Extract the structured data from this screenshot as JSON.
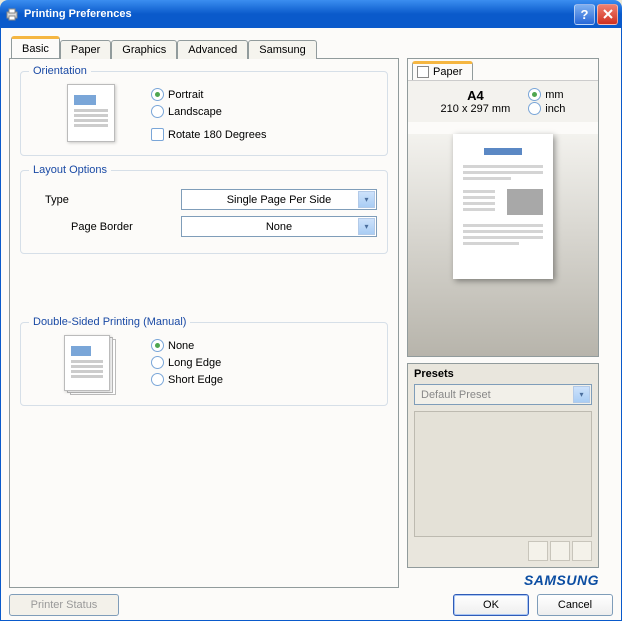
{
  "title": "Printing Preferences",
  "tabs": [
    "Basic",
    "Paper",
    "Graphics",
    "Advanced",
    "Samsung"
  ],
  "activeTab": 0,
  "orientation": {
    "legend": "Orientation",
    "options": {
      "portrait": "Portrait",
      "landscape": "Landscape"
    },
    "selected": "portrait",
    "rotate": "Rotate 180 Degrees",
    "rotateChecked": false
  },
  "layout": {
    "legend": "Layout Options",
    "typeLabel": "Type",
    "typeValue": "Single Page Per Side",
    "borderLabel": "Page Border",
    "borderValue": "None"
  },
  "duplex": {
    "legend": "Double-Sided Printing (Manual)",
    "options": {
      "none": "None",
      "long": "Long Edge",
      "short": "Short Edge"
    },
    "selected": "none"
  },
  "side": {
    "paperTab": "Paper",
    "size": "A4",
    "dims": "210 x 297 mm",
    "units": {
      "mm": "mm",
      "inch": "inch"
    },
    "unitSelected": "mm"
  },
  "presets": {
    "legend": "Presets",
    "value": "Default Preset"
  },
  "brand": "SAMSUNG",
  "buttons": {
    "status": "Printer Status",
    "ok": "OK",
    "cancel": "Cancel"
  }
}
